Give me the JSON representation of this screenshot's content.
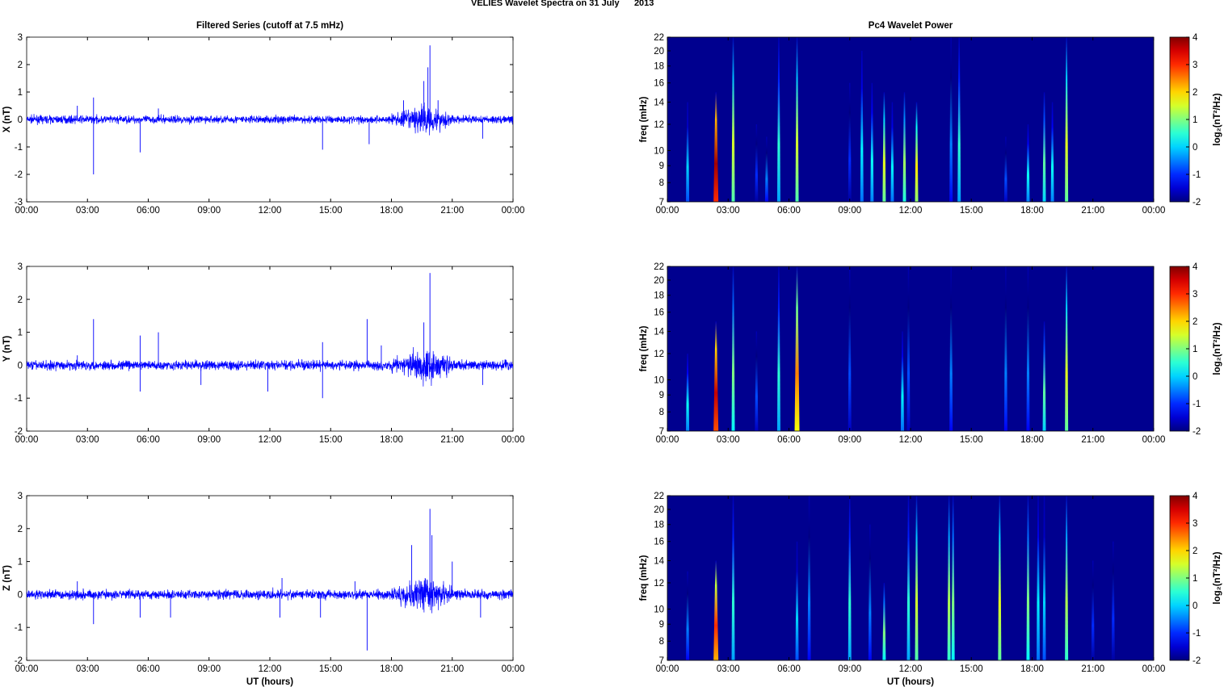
{
  "title": "VELIES Wavelet Spectra on 31 July      2013",
  "chart_data": {
    "type": "line+heatmap",
    "left_title": "Filtered Series (cutoff at 7.5 mHz)",
    "right_title": "Pc4 Wavelet Power",
    "xlabel": "UT (hours)",
    "xticks": [
      "00:00",
      "03:00",
      "06:00",
      "09:00",
      "12:00",
      "15:00",
      "18:00",
      "21:00",
      "00:00"
    ],
    "xlim": [
      0,
      24
    ],
    "freq_label": "freq (mHz)",
    "freq_ticks": [
      7,
      8,
      9,
      10,
      12,
      14,
      16,
      18,
      20,
      22
    ],
    "freq_lim": [
      7,
      22
    ],
    "colorbar": {
      "label": "log₂(nT²/Hz)",
      "ticks": [
        -2,
        -1,
        0,
        1,
        2,
        3,
        4
      ],
      "lim": [
        -2,
        4
      ],
      "colormap": "jet"
    },
    "colors": {
      "series": "#0000ff",
      "background_power": "#00008f"
    },
    "series": [
      {
        "name": "X (nT)",
        "ylim": [
          -3,
          3
        ],
        "yticks": [
          -3,
          -2,
          -1,
          0,
          1,
          2,
          3
        ],
        "noise": 0.07,
        "spikes": [
          [
            2.5,
            0.5
          ],
          [
            3.3,
            -2.0
          ],
          [
            3.3,
            0.8
          ],
          [
            5.6,
            -1.2
          ],
          [
            6.5,
            0.4
          ],
          [
            14.6,
            -1.1
          ],
          [
            16.9,
            -0.9
          ],
          [
            18.6,
            0.7
          ],
          [
            19.6,
            1.4
          ],
          [
            19.8,
            1.9
          ],
          [
            19.9,
            2.7
          ],
          [
            20.3,
            0.7
          ],
          [
            22.5,
            -0.7
          ]
        ],
        "spectra": [
          [
            1.0,
            0.0,
            14
          ],
          [
            2.4,
            3.8,
            15
          ],
          [
            3.25,
            1.5,
            22
          ],
          [
            4.4,
            -1.0,
            12
          ],
          [
            4.9,
            -0.5,
            11
          ],
          [
            5.5,
            0.5,
            22
          ],
          [
            6.4,
            1.5,
            22
          ],
          [
            9.0,
            -1.0,
            16
          ],
          [
            9.6,
            0.2,
            20
          ],
          [
            10.1,
            0.3,
            16
          ],
          [
            10.7,
            1.6,
            15
          ],
          [
            11.1,
            0.2,
            14
          ],
          [
            11.7,
            1.2,
            15
          ],
          [
            12.3,
            1.9,
            14
          ],
          [
            14.0,
            -0.5,
            22
          ],
          [
            14.4,
            0.5,
            22
          ],
          [
            16.7,
            -0.8,
            11
          ],
          [
            17.8,
            0.3,
            12
          ],
          [
            18.6,
            0.8,
            15
          ],
          [
            19.0,
            0.3,
            14
          ],
          [
            19.7,
            1.6,
            22
          ]
        ]
      },
      {
        "name": "Y (nT)",
        "ylim": [
          -2,
          3
        ],
        "yticks": [
          -2,
          -1,
          0,
          1,
          2,
          3
        ],
        "noise": 0.07,
        "spikes": [
          [
            2.5,
            0.3
          ],
          [
            3.3,
            1.4
          ],
          [
            5.6,
            -0.8
          ],
          [
            5.6,
            0.9
          ],
          [
            6.5,
            1.0
          ],
          [
            8.6,
            -0.6
          ],
          [
            11.9,
            -0.8
          ],
          [
            14.6,
            -1.0
          ],
          [
            14.6,
            0.7
          ],
          [
            16.8,
            1.4
          ],
          [
            17.5,
            0.6
          ],
          [
            19.6,
            1.3
          ],
          [
            19.9,
            2.8
          ],
          [
            22.5,
            -0.6
          ]
        ],
        "spectra": [
          [
            1.0,
            0.3,
            12
          ],
          [
            2.4,
            3.6,
            15
          ],
          [
            3.25,
            1.0,
            22
          ],
          [
            4.4,
            -0.8,
            14
          ],
          [
            5.5,
            0.5,
            22
          ],
          [
            6.4,
            2.5,
            22
          ],
          [
            9.0,
            -0.8,
            22
          ],
          [
            11.6,
            0.2,
            14
          ],
          [
            11.9,
            -0.8,
            22
          ],
          [
            14.0,
            -0.5,
            22
          ],
          [
            16.7,
            -0.5,
            22
          ],
          [
            17.8,
            -0.5,
            22
          ],
          [
            18.6,
            0.8,
            15
          ],
          [
            19.7,
            1.6,
            22
          ]
        ]
      },
      {
        "name": "Z (nT)",
        "ylim": [
          -2,
          3
        ],
        "yticks": [
          -2,
          -1,
          0,
          1,
          2,
          3
        ],
        "noise": 0.07,
        "spikes": [
          [
            2.5,
            0.4
          ],
          [
            3.3,
            -0.9
          ],
          [
            5.6,
            -0.7
          ],
          [
            7.1,
            -0.7
          ],
          [
            12.5,
            -0.7
          ],
          [
            12.6,
            0.5
          ],
          [
            14.5,
            -0.7
          ],
          [
            16.2,
            0.4
          ],
          [
            16.8,
            -1.7
          ],
          [
            19.0,
            1.5
          ],
          [
            19.9,
            2.6
          ],
          [
            20.0,
            1.8
          ],
          [
            21.0,
            1.0
          ],
          [
            22.4,
            -0.7
          ]
        ],
        "spectra": [
          [
            1.0,
            -0.5,
            13
          ],
          [
            2.4,
            3.0,
            14
          ],
          [
            3.25,
            0.5,
            22
          ],
          [
            6.4,
            0.0,
            16
          ],
          [
            7.0,
            -0.5,
            22
          ],
          [
            9.0,
            0.5,
            22
          ],
          [
            10.0,
            -0.5,
            18
          ],
          [
            10.7,
            1.0,
            12
          ],
          [
            11.9,
            0.5,
            22
          ],
          [
            12.3,
            1.5,
            22
          ],
          [
            13.9,
            1.3,
            22
          ],
          [
            14.1,
            1.0,
            22
          ],
          [
            16.4,
            1.6,
            22
          ],
          [
            17.8,
            1.0,
            22
          ],
          [
            18.3,
            0.2,
            22
          ],
          [
            18.6,
            0.0,
            22
          ],
          [
            19.7,
            1.3,
            22
          ],
          [
            21.0,
            -1.0,
            14
          ],
          [
            22.0,
            -1.0,
            16
          ]
        ]
      }
    ]
  }
}
